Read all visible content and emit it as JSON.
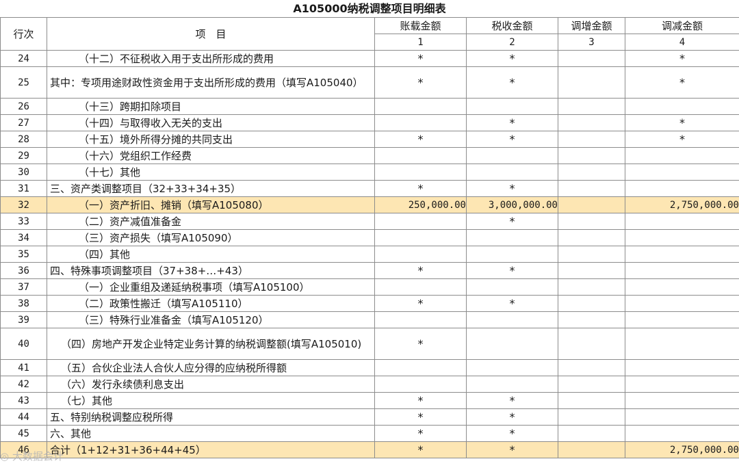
{
  "title": "A105000纳税调整项目明细表",
  "headers": {
    "row_no": "行次",
    "item": "项　目",
    "col1": "账载金额",
    "col2": "税收金额",
    "col3": "调增金额",
    "col4": "调减金额",
    "n1": "1",
    "n2": "2",
    "n3": "3",
    "n4": "4"
  },
  "rows": [
    {
      "no": "24",
      "indent": 2,
      "label": "（十二）不征税收入用于支出所形成的费用",
      "c1": "*",
      "c2": "*",
      "c3": "",
      "c4": "*"
    },
    {
      "no": "25",
      "indent": 0,
      "tall": true,
      "label": "其中：专项用途财政性资金用于支出所形成的费用（填写A105040）",
      "c1": "*",
      "c2": "*",
      "c3": "",
      "c4": "*"
    },
    {
      "no": "26",
      "indent": 2,
      "label": "（十三）跨期扣除项目",
      "c1": "",
      "c2": "",
      "c3": "",
      "c4": ""
    },
    {
      "no": "27",
      "indent": 2,
      "label": "（十四）与取得收入无关的支出",
      "c1": "",
      "c2": "*",
      "c3": "",
      "c4": "*"
    },
    {
      "no": "28",
      "indent": 2,
      "label": "（十五）境外所得分摊的共同支出",
      "c1": "*",
      "c2": "*",
      "c3": "",
      "c4": "*"
    },
    {
      "no": "29",
      "indent": 2,
      "label": "（十六）党组织工作经费",
      "c1": "",
      "c2": "",
      "c3": "",
      "c4": ""
    },
    {
      "no": "30",
      "indent": 2,
      "label": "（十七）其他",
      "c1": "",
      "c2": "",
      "c3": "",
      "c4": ""
    },
    {
      "no": "31",
      "indent": 0,
      "label": "三、资产类调整项目（32+33+34+35）",
      "c1": "*",
      "c2": "*",
      "c3": "",
      "c4": ""
    },
    {
      "no": "32",
      "indent": 2,
      "highlight": true,
      "label": "（一）资产折旧、摊销（填写A105080）",
      "c1": "250,000.00",
      "c2": "3,000,000.00",
      "c3": "",
      "c4": "2,750,000.00"
    },
    {
      "no": "33",
      "indent": 2,
      "label": "（二）资产减值准备金",
      "c1": "",
      "c2": "*",
      "c3": "",
      "c4": ""
    },
    {
      "no": "34",
      "indent": 2,
      "label": "（三）资产损失（填写A105090）",
      "c1": "",
      "c2": "",
      "c3": "",
      "c4": ""
    },
    {
      "no": "35",
      "indent": 2,
      "label": "（四）其他",
      "c1": "",
      "c2": "",
      "c3": "",
      "c4": ""
    },
    {
      "no": "36",
      "indent": 0,
      "label": "四、特殊事项调整项目（37+38+…+43）",
      "c1": "*",
      "c2": "*",
      "c3": "",
      "c4": ""
    },
    {
      "no": "37",
      "indent": 2,
      "label": "（一）企业重组及递延纳税事项（填写A105100）",
      "c1": "",
      "c2": "",
      "c3": "",
      "c4": ""
    },
    {
      "no": "38",
      "indent": 2,
      "label": "（二）政策性搬迁（填写A105110）",
      "c1": "*",
      "c2": "*",
      "c3": "",
      "c4": ""
    },
    {
      "no": "39",
      "indent": 2,
      "label": "（三）特殊行业准备金（填写A105120）",
      "c1": "",
      "c2": "",
      "c3": "",
      "c4": ""
    },
    {
      "no": "40",
      "indent": 1,
      "tall": true,
      "label": "（四）房地产开发企业特定业务计算的纳税调整额(填写A105010)",
      "c1": "*",
      "c2": "",
      "c3": "",
      "c4": ""
    },
    {
      "no": "41",
      "indent": 1,
      "label": "（五）合伙企业法人合伙人应分得的应纳税所得额",
      "c1": "",
      "c2": "",
      "c3": "",
      "c4": ""
    },
    {
      "no": "42",
      "indent": 1,
      "label": "（六）发行永续债利息支出",
      "c1": "",
      "c2": "",
      "c3": "",
      "c4": ""
    },
    {
      "no": "43",
      "indent": 1,
      "label": "（七）其他",
      "c1": "*",
      "c2": "*",
      "c3": "",
      "c4": ""
    },
    {
      "no": "44",
      "indent": 0,
      "label": "五、特别纳税调整应税所得",
      "c1": "*",
      "c2": "*",
      "c3": "",
      "c4": ""
    },
    {
      "no": "45",
      "indent": 0,
      "label": "六、其他",
      "c1": "*",
      "c2": "*",
      "c3": "",
      "c4": ""
    },
    {
      "no": "46",
      "indent": 0,
      "highlight": true,
      "label": "合计（1+12+31+36+44+45）",
      "c1": "*",
      "c2": "*",
      "c3": "",
      "c4": "2,750,000.00"
    }
  ],
  "watermark": "大数据会计"
}
